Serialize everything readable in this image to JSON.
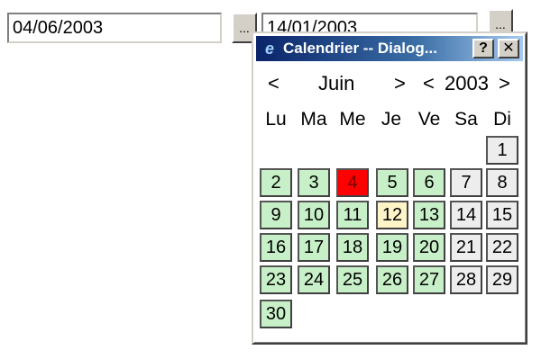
{
  "form": {
    "date1_value": "04/06/2003",
    "date2_value": "14/01/2003",
    "picker_button_label": "..."
  },
  "dialog": {
    "title": "Calendrier -- Dialog...",
    "help_label": "?",
    "close_label": "✕",
    "nav": {
      "prev_month": "<",
      "month": "Juin",
      "next_month": ">",
      "prev_year": "<",
      "year": "2003",
      "next_year": ">"
    },
    "weekdays": [
      "Lu",
      "Ma",
      "Me",
      "Je",
      "Ve",
      "Sa",
      "Di"
    ],
    "today_day": 4,
    "selected_day": 12,
    "days": [
      {
        "label": "1",
        "row": 0,
        "col": 6
      },
      {
        "label": "2",
        "row": 1,
        "col": 0
      },
      {
        "label": "3",
        "row": 1,
        "col": 1
      },
      {
        "label": "4",
        "row": 1,
        "col": 2
      },
      {
        "label": "5",
        "row": 1,
        "col": 3
      },
      {
        "label": "6",
        "row": 1,
        "col": 4
      },
      {
        "label": "7",
        "row": 1,
        "col": 5
      },
      {
        "label": "8",
        "row": 1,
        "col": 6
      },
      {
        "label": "9",
        "row": 2,
        "col": 0
      },
      {
        "label": "10",
        "row": 2,
        "col": 1
      },
      {
        "label": "11",
        "row": 2,
        "col": 2
      },
      {
        "label": "12",
        "row": 2,
        "col": 3
      },
      {
        "label": "13",
        "row": 2,
        "col": 4
      },
      {
        "label": "14",
        "row": 2,
        "col": 5
      },
      {
        "label": "15",
        "row": 2,
        "col": 6
      },
      {
        "label": "16",
        "row": 3,
        "col": 0
      },
      {
        "label": "17",
        "row": 3,
        "col": 1
      },
      {
        "label": "18",
        "row": 3,
        "col": 2
      },
      {
        "label": "19",
        "row": 3,
        "col": 3
      },
      {
        "label": "20",
        "row": 3,
        "col": 4
      },
      {
        "label": "21",
        "row": 3,
        "col": 5
      },
      {
        "label": "22",
        "row": 3,
        "col": 6
      },
      {
        "label": "23",
        "row": 4,
        "col": 0
      },
      {
        "label": "24",
        "row": 4,
        "col": 1
      },
      {
        "label": "25",
        "row": 4,
        "col": 2
      },
      {
        "label": "26",
        "row": 4,
        "col": 3
      },
      {
        "label": "27",
        "row": 4,
        "col": 4
      },
      {
        "label": "28",
        "row": 4,
        "col": 5
      },
      {
        "label": "29",
        "row": 4,
        "col": 6
      },
      {
        "label": "30",
        "row": 5,
        "col": 0
      }
    ],
    "colors": {
      "weekday_cell": "#c8f0c8",
      "weekend_cell": "#ededed",
      "today_cell": "#ff0000",
      "selected_cell": "#fff4c8"
    }
  }
}
